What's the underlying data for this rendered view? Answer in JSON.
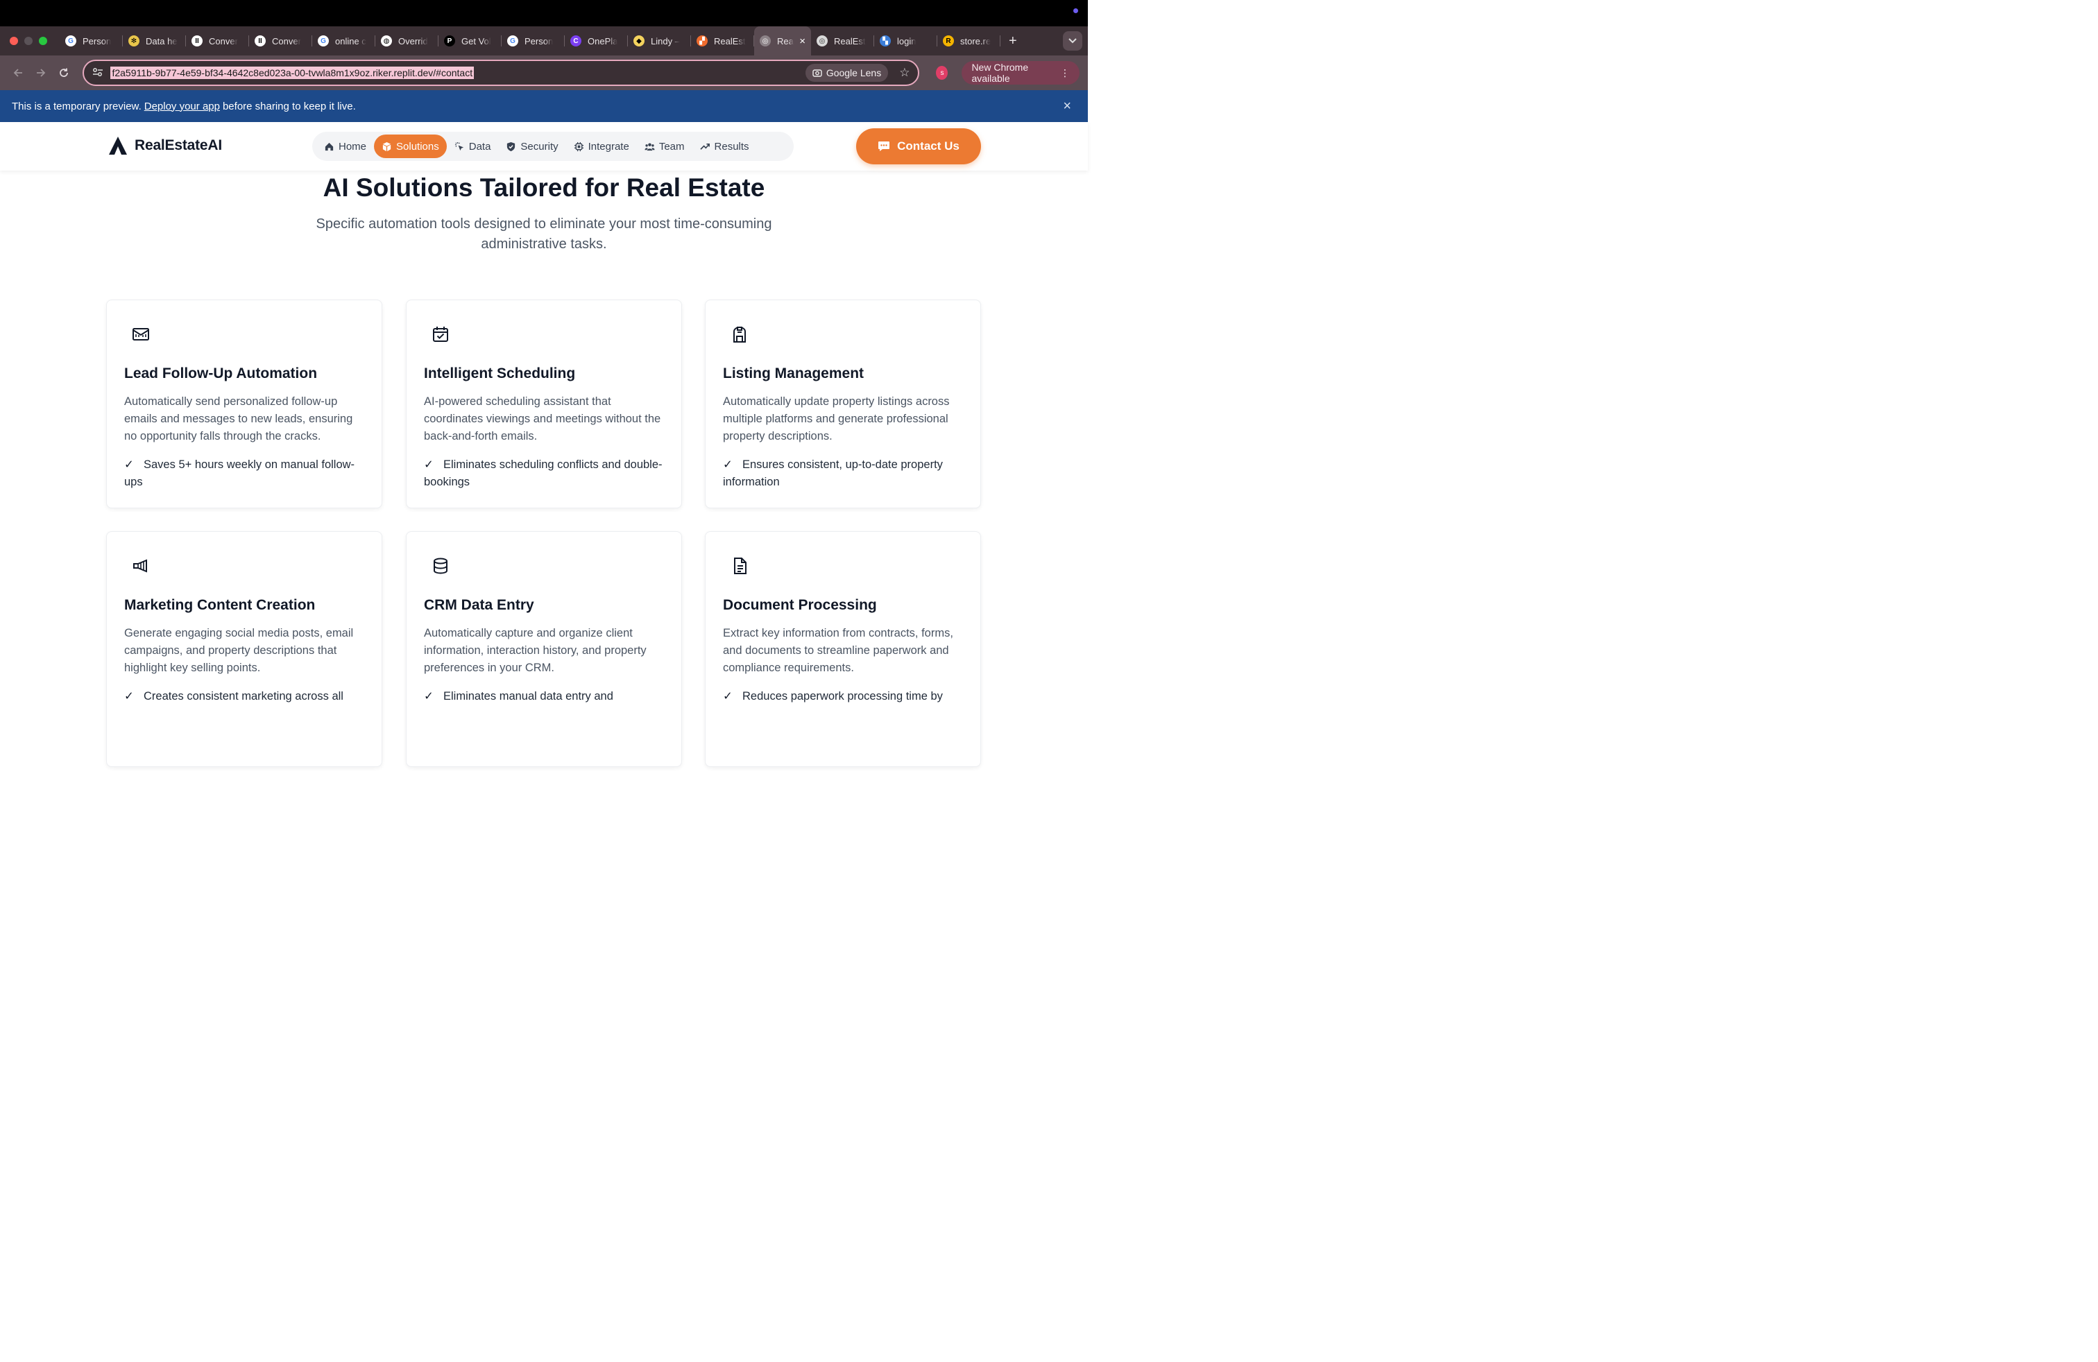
{
  "browser": {
    "tabs": [
      {
        "label": "Person",
        "fav": "G",
        "color": "#ffffff",
        "text": "#4285f4"
      },
      {
        "label": "Data he",
        "fav": "✻",
        "color": "#e9c64b",
        "text": "#000"
      },
      {
        "label": "Conver",
        "fav": "II",
        "color": "#ffffff",
        "text": "#000"
      },
      {
        "label": "Conver",
        "fav": "II",
        "color": "#ffffff",
        "text": "#000"
      },
      {
        "label": "online c",
        "fav": "G",
        "color": "#ffffff",
        "text": "#4285f4"
      },
      {
        "label": "Overrid",
        "fav": "◍",
        "color": "#ffffff",
        "text": "#000"
      },
      {
        "label": "Get Vol",
        "fav": "P",
        "color": "#000000",
        "text": "#fff"
      },
      {
        "label": "Person",
        "fav": "G",
        "color": "#ffffff",
        "text": "#4285f4"
      },
      {
        "label": "OnePla",
        "fav": "C",
        "color": "#7b3ff2",
        "text": "#fff"
      },
      {
        "label": "Lindy –",
        "fav": "◆",
        "color": "#f4d35e",
        "text": "#000"
      },
      {
        "label": "RealEst",
        "fav": "▞",
        "color": "#ef6b2d",
        "text": "#fff"
      }
    ],
    "active_tab": {
      "label": "Rea",
      "fav": "◎",
      "close": "×"
    },
    "tabs_after": [
      {
        "label": "RealEst",
        "fav": "◎",
        "color": "#d9d9d9",
        "text": "#333"
      },
      {
        "label": "login",
        "fav": "▚",
        "color": "#3b7dd8",
        "text": "#fff"
      },
      {
        "label": "store.re",
        "fav": "R",
        "color": "#f4b400",
        "text": "#000"
      }
    ],
    "new_tab": "+",
    "url": "f2a5911b-9b77-4e59-bf34-4642c8ed023a-00-tvwla8m1x9oz.riker.replit.dev/#contact",
    "lens_label": "Google Lens",
    "profile_initial": "s",
    "update_label": "New Chrome available"
  },
  "banner": {
    "before": "This is a temporary preview.",
    "link": "Deploy your app",
    "after": "before sharing to keep it live.",
    "close": "×"
  },
  "site": {
    "brand": "RealEstateAI",
    "nav": [
      {
        "label": "Home",
        "icon": "home-icon"
      },
      {
        "label": "Solutions",
        "icon": "cube-icon"
      },
      {
        "label": "Data",
        "icon": "cursor-click-icon"
      },
      {
        "label": "Security",
        "icon": "shield-icon"
      },
      {
        "label": "Integrate",
        "icon": "chip-icon"
      },
      {
        "label": "Team",
        "icon": "users-icon"
      },
      {
        "label": "Results",
        "icon": "trend-up-icon"
      }
    ],
    "active_nav": "Solutions",
    "contact_label": "Contact Us",
    "accent": "#ec7a32"
  },
  "section": {
    "title": "AI Solutions Tailored for Real Estate",
    "subtitle": "Specific automation tools designed to eliminate your most time-consuming administrative tasks.",
    "cards": [
      {
        "icon": "mail-icon",
        "title": "Lead Follow-Up Automation",
        "description": "Automatically send personalized follow-up emails and messages to new leads, ensuring no opportunity falls through the cracks.",
        "benefit": "Saves 5+ hours weekly on manual follow-ups"
      },
      {
        "icon": "calendar-check-icon",
        "title": "Intelligent Scheduling",
        "description": "AI-powered scheduling assistant that coordinates viewings and meetings without the back-and-forth emails.",
        "benefit": "Eliminates scheduling conflicts and double-bookings"
      },
      {
        "icon": "building-icon",
        "title": "Listing Management",
        "description": "Automatically update property listings across multiple platforms and generate professional property descriptions.",
        "benefit": "Ensures consistent, up-to-date property information"
      },
      {
        "icon": "megaphone-icon",
        "title": "Marketing Content Creation",
        "description": "Generate engaging social media posts, email campaigns, and property descriptions that highlight key selling points.",
        "benefit": "Creates consistent marketing across all"
      },
      {
        "icon": "database-icon",
        "title": "CRM Data Entry",
        "description": "Automatically capture and organize client information, interaction history, and property preferences in your CRM.",
        "benefit": "Eliminates manual data entry and"
      },
      {
        "icon": "document-icon",
        "title": "Document Processing",
        "description": "Extract key information from contracts, forms, and documents to streamline paperwork and compliance requirements.",
        "benefit": "Reduces paperwork processing time by"
      }
    ]
  }
}
